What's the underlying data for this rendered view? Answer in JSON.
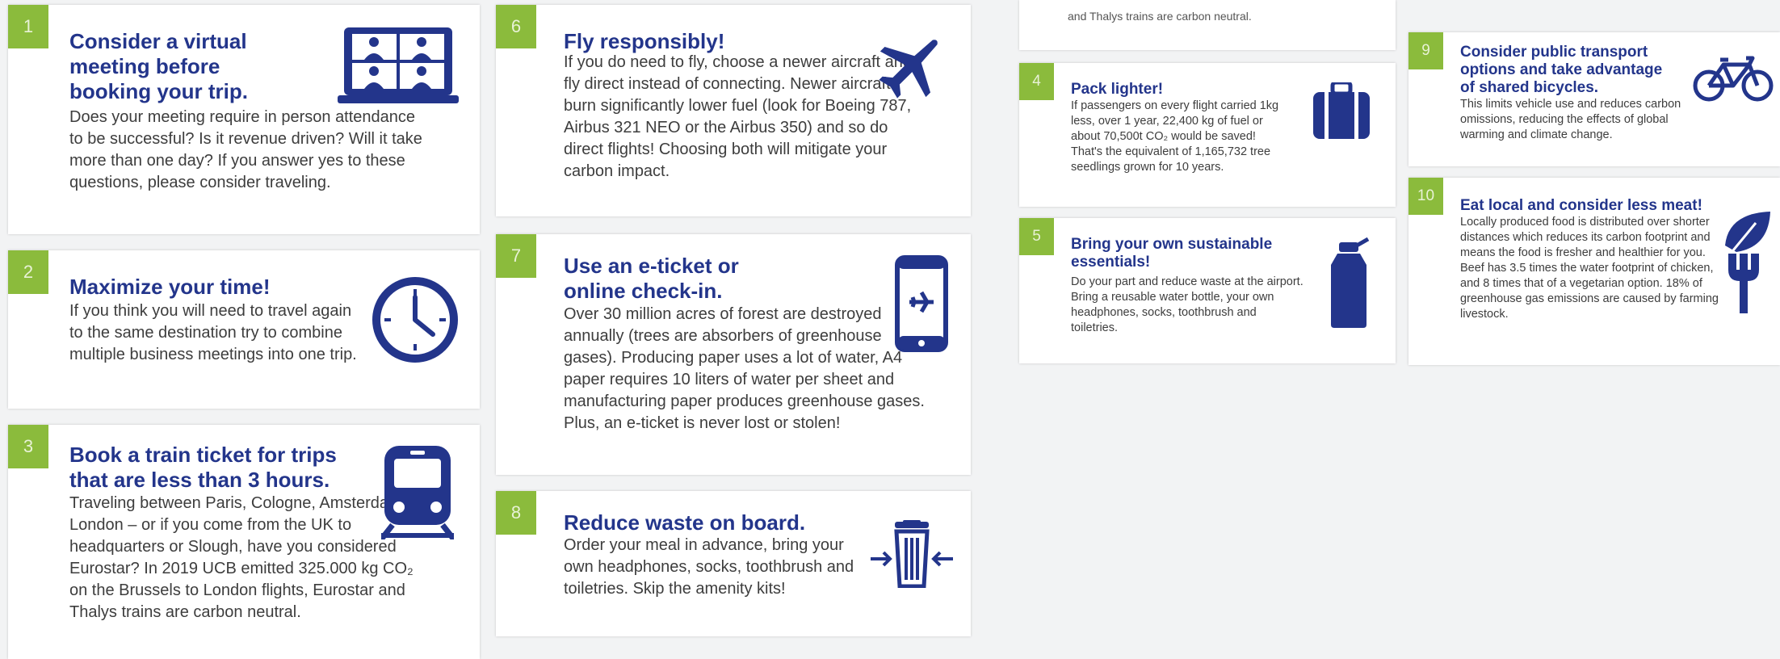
{
  "colors": {
    "accent_green": "#8bbb3c",
    "brand_blue": "#23358b",
    "text": "#3d3d3d"
  },
  "cards": {
    "c1": {
      "num": "1",
      "title": "Consider a virtual meeting before booking your trip.",
      "icon": "video-conference-icon",
      "body": "Does your meeting require in person attendance to be successful? Is it revenue driven? Will it take more than one day? If you answer yes to these questions, please consider traveling."
    },
    "c2": {
      "num": "2",
      "title": "Maximize your time!",
      "icon": "clock-icon",
      "body": "If you think you will need to travel again to the same destination try to combine multiple business meetings into one trip."
    },
    "c3": {
      "num": "3",
      "title": "Book a train ticket for trips that are less than 3 hours.",
      "icon": "train-icon",
      "body": "Traveling between Paris, Cologne, Amsterdam, London – or if you come from the UK to headquarters or Slough, have you considered Eurostar? In 2019 UCB emitted 325.000 kg CO₂ on the Brussels to London flights, Eurostar and Thalys trains are carbon neutral."
    },
    "c6": {
      "num": "6",
      "title": "Fly responsibly!",
      "icon": "airplane-icon",
      "body": "If you do need to fly, choose a newer aircraft and fly direct instead of connecting. Newer aircrafts burn significantly lower fuel (look for Boeing 787, Airbus 321 NEO or the Airbus 350) and so do direct flights! Choosing both will mitigate your carbon impact."
    },
    "c7": {
      "num": "7",
      "title": "Use an e-ticket or online check-in.",
      "icon": "phone-eticket-icon",
      "body": "Over 30 million acres of forest are destroyed annually (trees are absorbers of greenhouse gases). Producing paper uses a lot of water, A4 paper requires 10 liters of water per sheet and manufacturing paper produces greenhouse gases. Plus, an e-ticket is never lost or stolen!"
    },
    "c8": {
      "num": "8",
      "title": "Reduce waste on board.",
      "icon": "trash-bin-icon",
      "body": "Order your meal in advance, bring your own headphones, socks, toothbrush and toiletries. Skip the amenity kits!"
    },
    "c_cut": {
      "text": "and Thalys trains are carbon neutral."
    },
    "c4": {
      "num": "4",
      "title": "Pack lighter!",
      "icon": "suitcase-icon",
      "body": "If passengers on every flight carried 1kg less, over 1 year, 22,400 kg of fuel or about 70,500t CO₂ would be saved! That's the equivalent of 1,165,732 tree seedlings grown for 10 years."
    },
    "c5": {
      "num": "5",
      "title": "Bring your own sustainable essentials!",
      "icon": "water-bottle-icon",
      "body": "Do your part and reduce waste at the airport. Bring a reusable water bottle, your own headphones, socks, toothbrush and toiletries."
    },
    "c9": {
      "num": "9",
      "title": "Consider public transport options and take advantage of shared bicycles.",
      "icon": "bicycle-icon",
      "body": "This limits vehicle use and reduces carbon omissions, reducing the effects of global warming and climate change."
    },
    "c10": {
      "num": "10",
      "title": "Eat local and consider less meat!",
      "icon": "leaf-fork-icon",
      "body": "Locally produced food is distributed over shorter distances which reduces its carbon footprint and means the food is fresher and healthier for you. Beef has 3.5 times the water footprint of chicken, and 8 times that of a vegetarian option. 18% of greenhouse gas emissions are caused by farming livestock."
    }
  }
}
